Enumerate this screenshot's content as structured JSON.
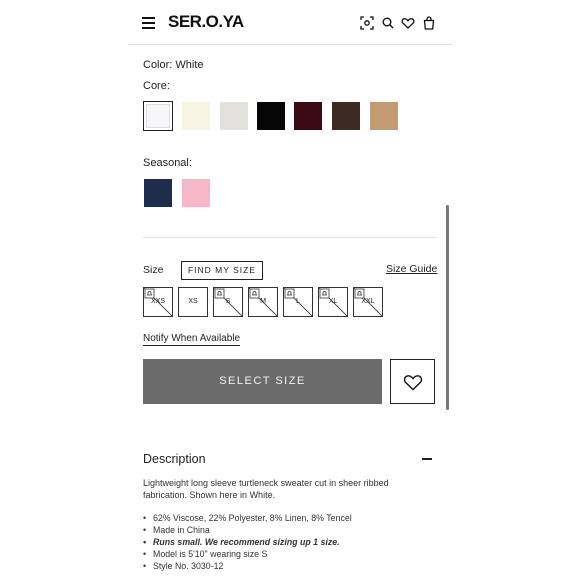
{
  "header": {
    "logo": "SER.O.YA",
    "icons": [
      "menu-icon",
      "scan-icon",
      "search-icon",
      "heart-icon",
      "bag-icon"
    ]
  },
  "color": {
    "label": "Color:",
    "value": "White",
    "core_label": "Core:",
    "core_swatches": [
      "#f7f7f9",
      "#f6f4e2",
      "#e3e1dd",
      "#050505",
      "#3b0a14",
      "#3d2a20",
      "#c49a72"
    ],
    "seasonal_label": "Seasonal:",
    "seasonal_swatches": [
      "#1f2d4c",
      "#f6b8c8"
    ]
  },
  "size": {
    "label": "Size",
    "find_my_size": "FIND MY SIZE",
    "size_guide": "Size Guide",
    "options": [
      "XXS",
      "XS",
      "S",
      "M",
      "L",
      "XL",
      "XXL"
    ],
    "notify": "Notify When Available"
  },
  "actions": {
    "select_size": "SELECT SIZE"
  },
  "description": {
    "title": "Description",
    "text": "Lightweight long sleeve turtleneck sweater cut in sheer ribbed fabrication. Shown here in White.",
    "bullets": [
      "62% Viscose, 22% Polyester, 8% Linen, 8% Tencel",
      "Made in China",
      "Runs small. We recommend sizing up 1 size.",
      "Model is 5'10\" wearing size S",
      "Style No. 3030-12"
    ]
  }
}
